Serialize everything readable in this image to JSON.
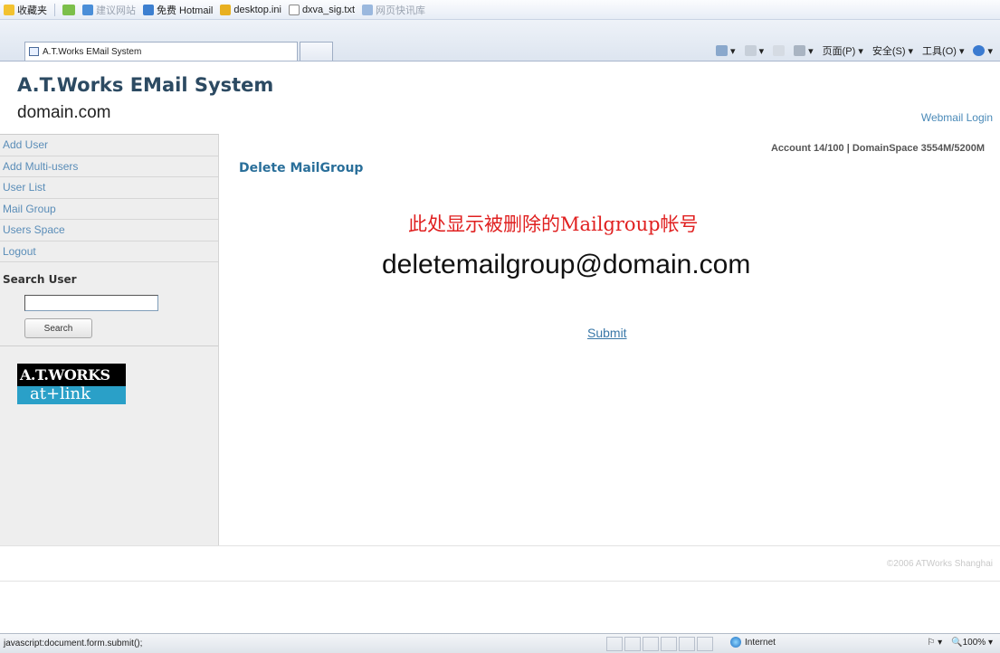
{
  "browser": {
    "favorites_label": "收藏夹",
    "favorites": [
      {
        "label": "建议网站",
        "faded": true
      },
      {
        "label": "免费 Hotmail",
        "faded": false
      },
      {
        "label": "desktop.ini",
        "faded": false
      },
      {
        "label": "dxva_sig.txt",
        "faded": false
      },
      {
        "label": "网页快讯库",
        "faded": true
      }
    ],
    "tab_title": "A.T.Works EMail System",
    "commands": {
      "page": "页面(P)",
      "safety": "安全(S)",
      "tools": "工具(O)"
    },
    "status_text": "javascript:document.form.submit();",
    "zone": "Internet",
    "zoom": "100%"
  },
  "header": {
    "title": "A.T.Works EMail System",
    "domain": "domain.com",
    "login_link": "Webmail Login"
  },
  "sidebar": {
    "items": [
      {
        "label": "Add User"
      },
      {
        "label": "Add Multi-users"
      },
      {
        "label": "User List"
      },
      {
        "label": "Mail Group"
      },
      {
        "label": "Users Space"
      },
      {
        "label": "Logout"
      }
    ],
    "search_title": "Search User",
    "search_value": "",
    "search_button": "Search",
    "logo_top": "A.T.WORKS",
    "logo_bottom": "at+link"
  },
  "main": {
    "account_info": "Account 14/100 | DomainSpace 3554M/5200M",
    "section_title": "Delete MailGroup",
    "annotation": "此处显示被删除的Mailgroup帐号",
    "mail_address": "deletemailgroup@domain.com",
    "submit": "Submit"
  },
  "footer": {
    "copyright": "©2006 ATWorks Shanghai"
  },
  "colors": {
    "accent": "#2a6f9a",
    "link": "#5a8db8",
    "annotation": "#e02020",
    "sidebar_bg": "#eeeeee",
    "logo_blue": "#2aa0c8"
  }
}
